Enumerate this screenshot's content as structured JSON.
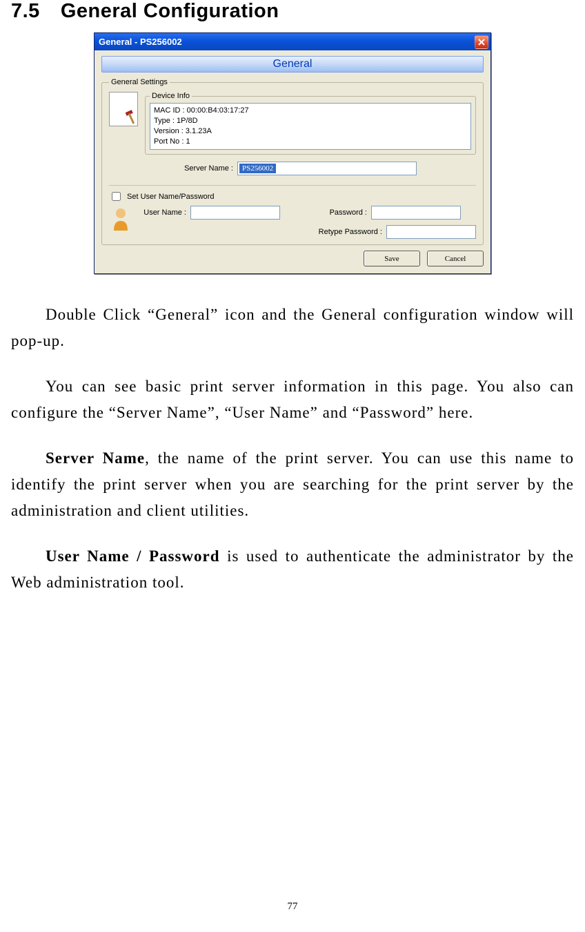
{
  "heading": {
    "number": "7.5",
    "title": "General Configuration"
  },
  "dialog": {
    "title": "General - PS256002",
    "banner": "General",
    "general_settings_legend": "General Settings",
    "device_info_legend": "Device Info",
    "info_lines": {
      "mac": "MAC ID : 00:00:B4:03:17:27",
      "type": "Type : 1P/8D",
      "version": "Version : 3.1.23A",
      "port": "Port No : 1"
    },
    "server_name_label": "Server Name :",
    "server_name_value": "PS256002",
    "set_user_pw_label": "Set User Name/Password",
    "user_name_label": "User Name :",
    "password_label": "Password :",
    "retype_password_label": "Retype Password :",
    "save_label": "Save",
    "cancel_label": "Cancel"
  },
  "paragraphs": {
    "p1": "Double Click “General” icon and the General configuration window will pop-up.",
    "p2": "You can see basic print server information in this page. You also can configure the “Server Name”, “User Name” and “Password” here.",
    "p3_bold": "Server Name",
    "p3_rest": ", the name of the print server. You can use this name to identify the print server when you are searching for the print server by the administration and client utilities.",
    "p4_bold": "User Name / Password",
    "p4_rest": " is used to authenticate the administrator by the Web administration tool."
  },
  "page_number": "77"
}
